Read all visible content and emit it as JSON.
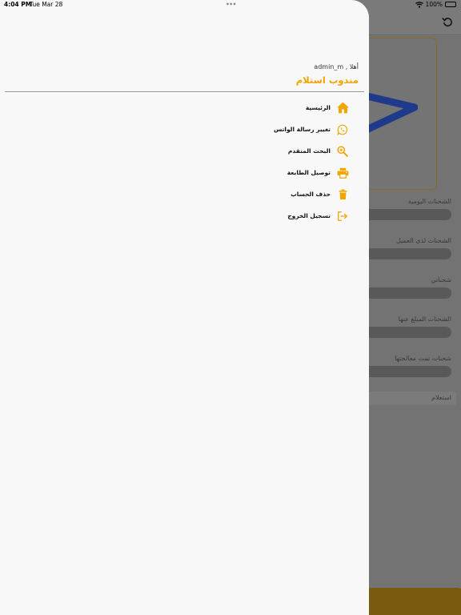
{
  "status_bar": {
    "time": "4:04 PM",
    "date": "Tue Mar 28",
    "battery": "100%",
    "battery_level": 1.0
  },
  "background": {
    "items": [
      "الشحنات اليومية",
      "الشحنات لدى العميل",
      "شحناتي",
      "الشحنات المبلغ عنها",
      "شحنات تمت معالجتها",
      "استعلام"
    ]
  },
  "drawer": {
    "greeting": "أهلا , admin_m",
    "role_title": "مندوب استلام",
    "menu": [
      {
        "label": "الرئيسية",
        "icon": "home-icon"
      },
      {
        "label": "تغيير رسالة الواتس",
        "icon": "whatsapp-icon"
      },
      {
        "label": "البحث المتقدم",
        "icon": "search-icon"
      },
      {
        "label": "توصيل الطابعة",
        "icon": "printer-icon"
      },
      {
        "label": "حذف الحساب",
        "icon": "trash-icon"
      },
      {
        "label": "تسجيل الخروج",
        "icon": "logout-icon"
      }
    ]
  },
  "colors": {
    "accent": "#f0a500",
    "drawer_bg": "#f8f8f8",
    "overlay": "#737373"
  }
}
